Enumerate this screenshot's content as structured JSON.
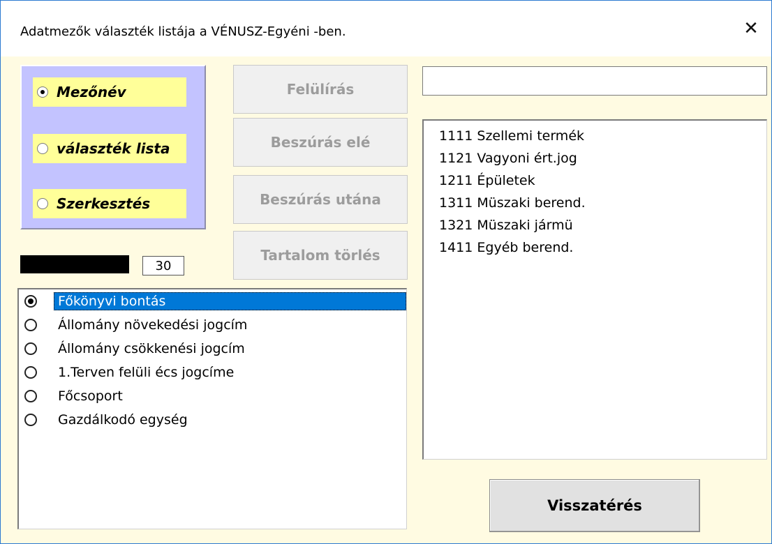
{
  "window": {
    "title": "Adatmezők választék listája a VÉNUSZ-Egyéni -ben.",
    "close_glyph": "✕"
  },
  "mode_options": [
    {
      "label": "Mezőnév",
      "checked": true
    },
    {
      "label": "választék lista",
      "checked": false
    },
    {
      "label": "Szerkesztés",
      "checked": false
    }
  ],
  "counter": {
    "value": "30"
  },
  "actions": {
    "overwrite_label": "Felülírás",
    "insert_before_label": "Beszúrás elé",
    "insert_after_label": "Beszúrás utána",
    "clear_label": "Tartalom törlés"
  },
  "edit_field": {
    "value": ""
  },
  "right_list": {
    "items": [
      "1111 Szellemi termék",
      "1121 Vagyoni ért.jog",
      "1211 Épületek",
      "1311 Müszaki berend.",
      "1321 Müszaki jármü",
      "1411 Egyéb berend."
    ]
  },
  "left_list": {
    "items": [
      {
        "label": "Főkönyvi bontás",
        "selected": true
      },
      {
        "label": "Állomány növekedési jogcím",
        "selected": false
      },
      {
        "label": "Állomány csökkenési jogcím",
        "selected": false
      },
      {
        "label": "1.Terven felüli écs jogcíme",
        "selected": false
      },
      {
        "label": "Főcsoport",
        "selected": false
      },
      {
        "label": "Gazdálkodó egység",
        "selected": false
      }
    ]
  },
  "footer": {
    "back_label": "Visszatérés"
  },
  "colors": {
    "window_bg": "#fffbe2",
    "panel_bg": "#c3c3ff",
    "option_bg": "#ffff99",
    "selection": "#0078d7",
    "disabled_text": "#9c9c9c"
  }
}
